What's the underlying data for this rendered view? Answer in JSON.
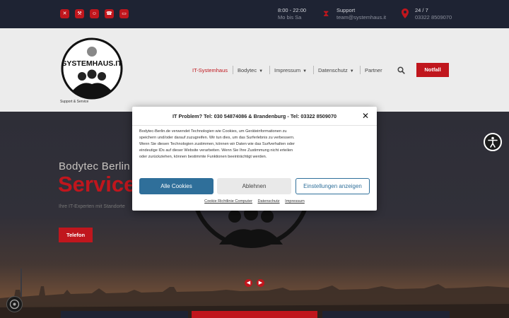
{
  "topbar": {
    "social_icons": [
      "xing-icon",
      "tools-icon",
      "support-icon",
      "phone-icon",
      "laptop-icon"
    ],
    "hours": {
      "title": "8:00 - 22:00",
      "sub": "Mo bis Sa"
    },
    "support": {
      "title": "Support",
      "sub": "team@systemhaus.it"
    },
    "location": {
      "title": "24 / 7",
      "sub": "03322 8509070"
    }
  },
  "header": {
    "logo_text": "SYSTEMHAUS.IT",
    "tagline": "Support & Service",
    "nav": [
      {
        "label": "IT-Systemhaus",
        "active": true,
        "dropdown": false
      },
      {
        "label": "Bodytec",
        "active": false,
        "dropdown": true
      },
      {
        "label": "Impressum",
        "active": false,
        "dropdown": true
      },
      {
        "label": "Datenschutz",
        "active": false,
        "dropdown": true
      },
      {
        "label": "Partner",
        "active": false,
        "dropdown": false
      }
    ],
    "notfall_label": "Notfall"
  },
  "hero": {
    "title": "Bodytec Berlin",
    "big": "Service",
    "sub": "Ihre IT-Experten mit Standorte",
    "button": "Telefon"
  },
  "cookie": {
    "title": "IT Problem? Tel: 030 54874086 & Brandenburg - Tel: 03322 8509070",
    "close": "✕",
    "body": "Bodytec-Berlin.de verwendet Technologien wie Cookies, um Geräteinformationen zu speichern und/oder darauf zuzugreifen. Wir tun dies, um das Surferlebnis zu verbessern. Wenn Sie diesen Technologien zustimmen, können wir Daten wie das Surfverhalten oder eindeutige IDs auf dieser Website verarbeiten. Wenn Sie Ihre Zustimmung nicht erteilen oder zurückziehen, können bestimmte Funktionen beeinträchtigt werden.",
    "accept": "Alle Cookies",
    "deny": "Ablehnen",
    "settings": "Einstellungen anzeigen",
    "links": [
      "Cookie Richtlinie Computer",
      "Datenschutz",
      "Impressum"
    ]
  },
  "colors": {
    "brand_red": "#c0161d",
    "accent_blue": "#2f6f9a",
    "topbar_bg": "#1e2333"
  }
}
